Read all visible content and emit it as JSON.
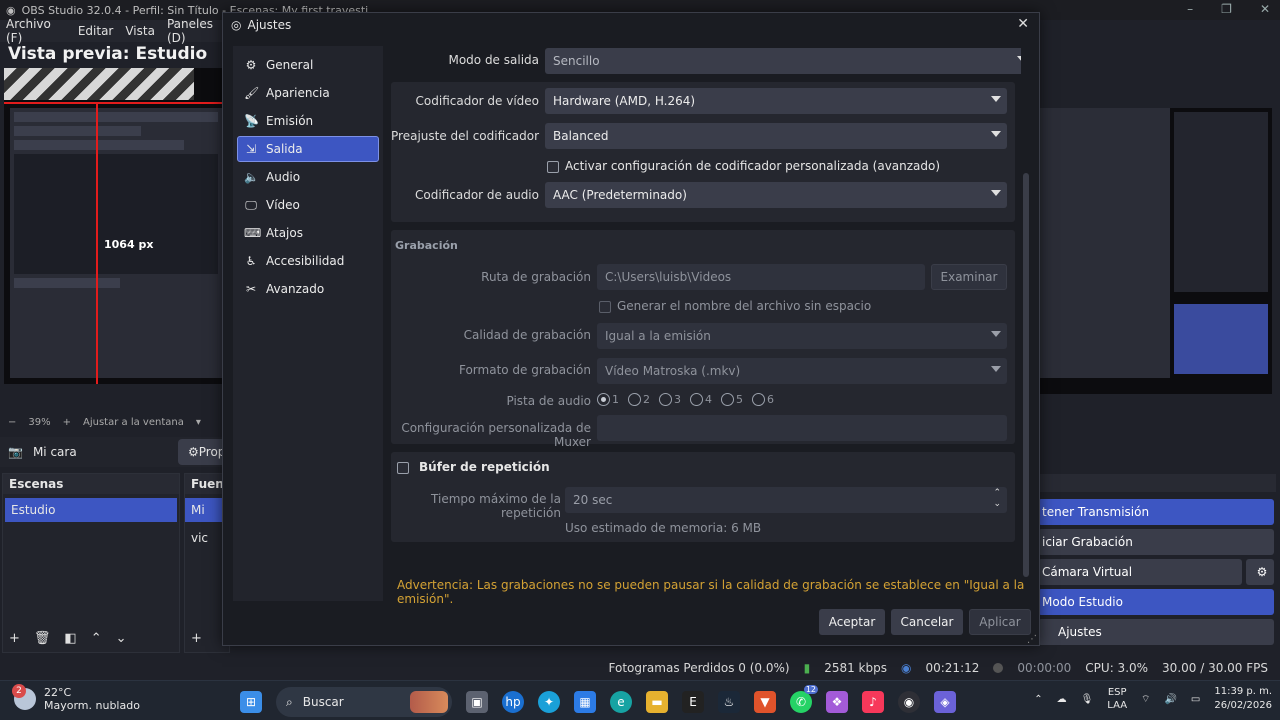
{
  "obs": {
    "title": "OBS Studio 32.0.4 - Perfil: Sin Título - Escenas: My first travesti",
    "menu": [
      "Archivo (F)",
      "Editar",
      "Vista",
      "Paneles (D)"
    ],
    "preview_title": "Vista previa: Estudio",
    "preview_px_label": "1064 px",
    "zoom_label": "39%",
    "fit_label": "Ajustar a la ventana",
    "source_selected": "Mi cara",
    "properties_label": "Prop",
    "scenes_title": "Escenas",
    "scenes": [
      "Estudio"
    ],
    "sources_title": "Fuente",
    "sources": [
      "Mi",
      "vic"
    ],
    "controls": [
      {
        "label": "tener Transmisión",
        "style": "blue"
      },
      {
        "label": "iciar Grabación",
        "style": "gray"
      },
      {
        "label": "Cámara Virtual",
        "style": "gray"
      },
      {
        "label": "Modo Estudio",
        "style": "blue"
      },
      {
        "label": "Ajustes",
        "style": "gray"
      }
    ]
  },
  "statusbar": {
    "dropped_frames": "Fotogramas Perdidos 0 (0.0%)",
    "kbps": "2581 kbps",
    "stream_time": "00:21:12",
    "rec_time": "00:00:00",
    "cpu": "CPU: 3.0%",
    "fps": "30.00 / 30.00 FPS"
  },
  "dialog": {
    "title": "Ajustes",
    "nav": [
      {
        "label": "General",
        "icon": "gear-icon",
        "glyph": "⚙"
      },
      {
        "label": "Apariencia",
        "icon": "brush-icon",
        "glyph": "🖌"
      },
      {
        "label": "Emisión",
        "icon": "antenna-icon",
        "glyph": "📡"
      },
      {
        "label": "Salida",
        "icon": "output-icon",
        "glyph": "⇲"
      },
      {
        "label": "Audio",
        "icon": "speaker-icon",
        "glyph": "🔈"
      },
      {
        "label": "Vídeo",
        "icon": "monitor-icon",
        "glyph": "🖵"
      },
      {
        "label": "Atajos",
        "icon": "keyboard-icon",
        "glyph": "⌨"
      },
      {
        "label": "Accesibilidad",
        "icon": "accessibility-icon",
        "glyph": "♿"
      },
      {
        "label": "Avanzado",
        "icon": "tools-icon",
        "glyph": "✂"
      }
    ],
    "selected_nav": "Salida",
    "output_mode_label": "Modo de salida",
    "output_mode_value": "Sencillo",
    "streaming": {
      "video_encoder_label": "Codificador de vídeo",
      "video_encoder_value": "Hardware (AMD, H.264)",
      "encoder_preset_label": "Preajuste del codificador",
      "encoder_preset_value": "Balanced",
      "custom_encoder_label": "Activar configuración de codificador personalizada (avanzado)",
      "custom_encoder_checked": false,
      "audio_encoder_label": "Codificador de audio",
      "audio_encoder_value": "AAC (Predeterminado)"
    },
    "recording": {
      "section_title": "Grabación",
      "path_label": "Ruta de grabación",
      "path_value": "C:\\Users\\luisb\\Videos",
      "browse_label": "Examinar",
      "no_space_label": "Generar el nombre del archivo sin espacio",
      "quality_label": "Calidad de grabación",
      "quality_value": "Igual a la emisión",
      "format_label": "Formato de grabación",
      "format_value": "Vídeo Matroska (.mkv)",
      "audio_track_label": "Pista de audio",
      "audio_tracks": [
        "1",
        "2",
        "3",
        "4",
        "5",
        "6"
      ],
      "audio_track_selected": "1",
      "muxer_label": "Configuración personalizada de Muxer",
      "muxer_value": ""
    },
    "replay": {
      "title": "Búfer de repetición",
      "checked": false,
      "max_time_label": "Tiempo máximo de la repetición",
      "max_time_value": "20 sec",
      "memory_label": "Uso estimado de memoria: 6 MB"
    },
    "warning": "Advertencia: Las grabaciones no se pueden pausar si la calidad de grabación se establece en \"Igual a la emisión\".",
    "buttons": {
      "accept": "Aceptar",
      "cancel": "Cancelar",
      "apply": "Aplicar"
    }
  },
  "taskbar": {
    "weather_temp": "22°C",
    "weather_desc": "Mayorm. nublado",
    "weather_badge": "2",
    "search_label": "Buscar",
    "lang_top": "ESP",
    "lang_bottom": "LAA",
    "time": "11:39 p. m.",
    "date": "26/02/2026",
    "whatsapp_badge": "12"
  },
  "colors": {
    "accent": "#3d56c2",
    "warning": "#d4a234",
    "dialog_bg": "#1a1c22",
    "panel_bg": "#25272f"
  }
}
